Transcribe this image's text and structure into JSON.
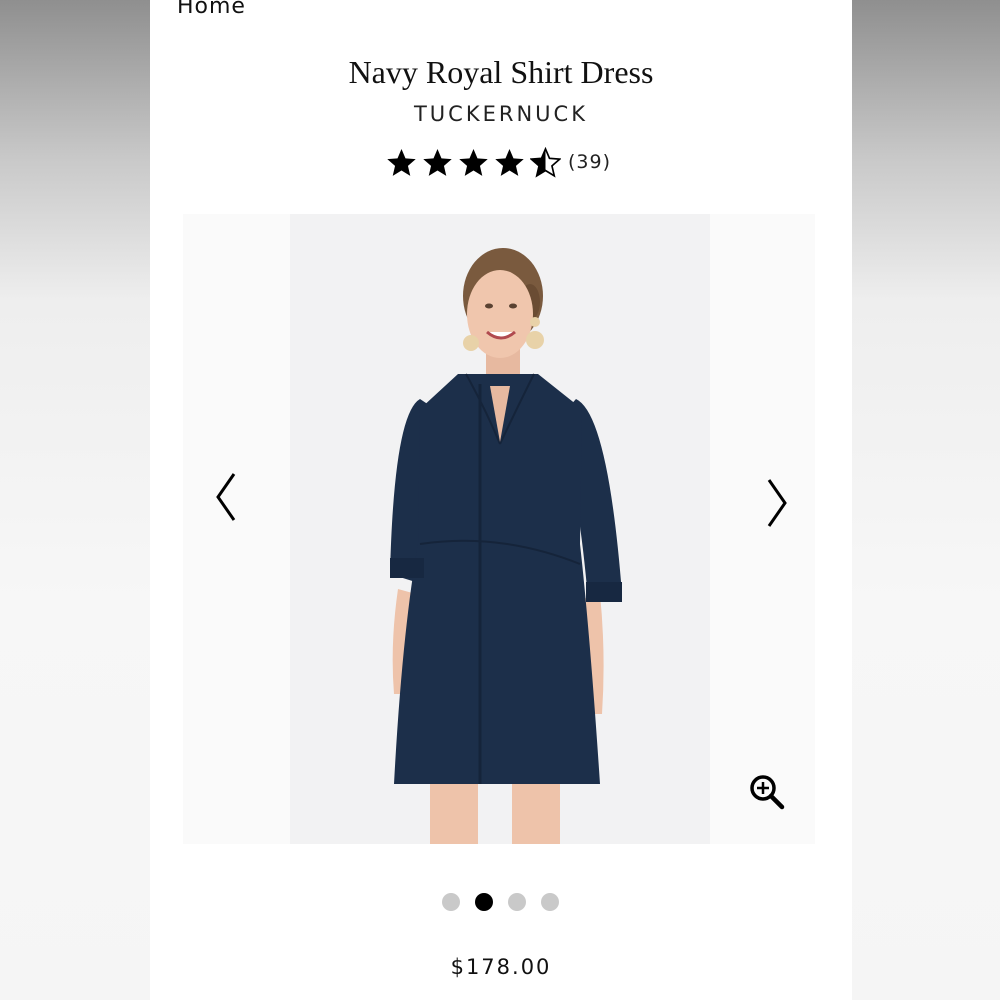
{
  "breadcrumb": {
    "label": "Home"
  },
  "product": {
    "title": "Navy Royal Shirt Dress",
    "brand": "TUCKERNUCK",
    "rating": 4.5,
    "rating_max": 5,
    "review_count": "(39)",
    "price": "$178.00",
    "color_swatch": "#1c2f4a"
  },
  "gallery": {
    "icons": {
      "prev": "chevron-left-icon",
      "next": "chevron-right-icon",
      "zoom": "zoom-in-icon"
    },
    "image_count": 4,
    "active_index": 1
  },
  "colors": {
    "dress": "#1c2f4a",
    "dot_inactive": "#c9c9c9",
    "dot_active": "#000000",
    "star": "#000000"
  }
}
